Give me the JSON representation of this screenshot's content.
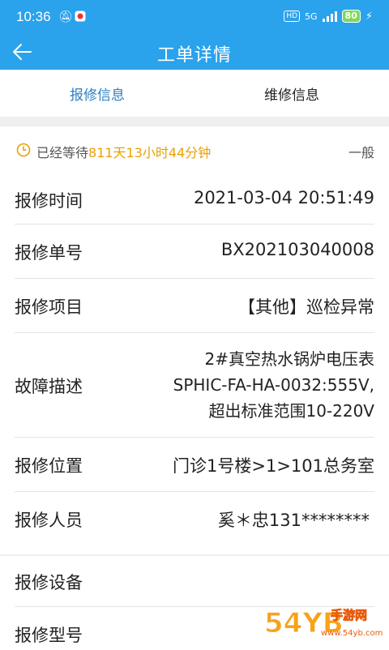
{
  "status_bar": {
    "time": "10:36",
    "network": "5G",
    "battery": "80"
  },
  "header": {
    "title": "工单详情"
  },
  "tabs": [
    {
      "label": "报修信息",
      "active": true
    },
    {
      "label": "维修信息",
      "active": false
    }
  ],
  "wait": {
    "prefix": "已经等待",
    "duration": "811天13小时44分钟",
    "level": "一般"
  },
  "details": [
    {
      "label": "报修时间",
      "value": "2021-03-04 20:51:49"
    },
    {
      "label": "报修单号",
      "value": "BX202103040008"
    },
    {
      "label": "报修项目",
      "value": "【其他】巡检异常"
    },
    {
      "label": "故障描述",
      "value_lines": [
        "2#真空热水锅炉电压表",
        "SPHIC-FA-HA-0032:555V,",
        "超出标准范围10-220V"
      ]
    },
    {
      "label": "报修位置",
      "value": "门诊1号楼>1>101总务室"
    },
    {
      "label": "报修人员",
      "value": "奚＊忠131********"
    }
  ],
  "equipment": [
    {
      "label": "报修设备"
    },
    {
      "label": "报修型号"
    }
  ],
  "watermark": {
    "main": "54YB",
    "sub": "手游网",
    "url": "www.54yb.com"
  },
  "colors": {
    "primary": "#2aa2ec",
    "tab_active": "#2c7fc4",
    "highlight": "#e8a100"
  }
}
